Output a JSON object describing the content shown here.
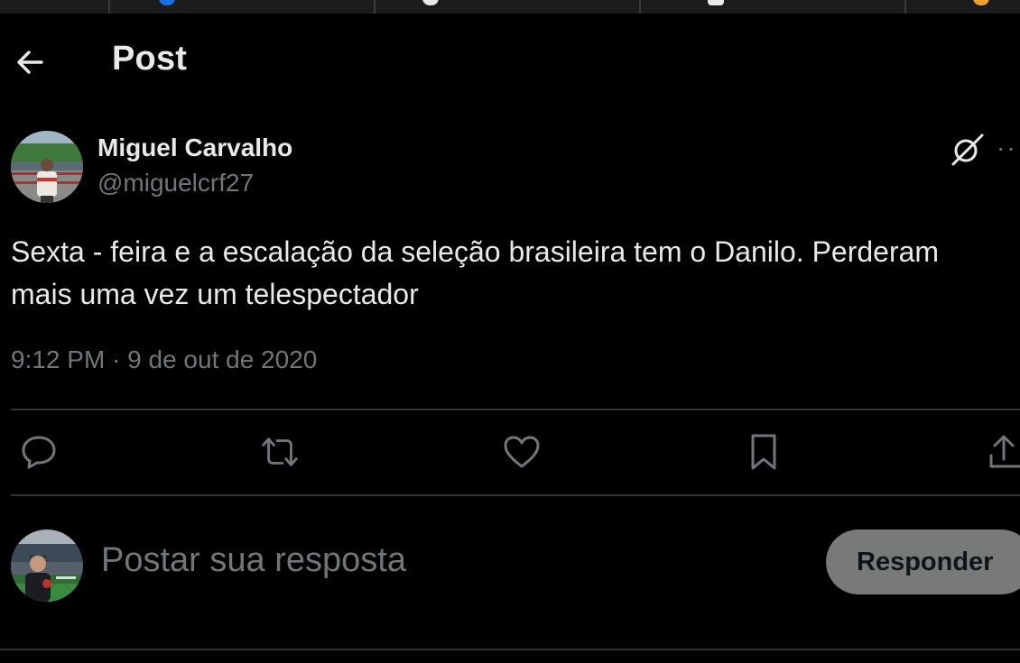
{
  "header": {
    "title": "Post",
    "back_icon": "arrow-left-icon"
  },
  "post": {
    "author_name": "Miguel Carvalho",
    "author_handle": "@miguelcrf27",
    "text_line1": "Sexta - feira e a escalação da seleção brasileira tem o Danilo. Perderam",
    "text_line2": "mais uma vez um telespectador",
    "timestamp": "9:12 PM · 9 de out de 2020",
    "more_label": "··"
  },
  "actions": [
    "reply-icon",
    "repost-icon",
    "like-icon",
    "bookmark-icon",
    "share-icon"
  ],
  "compose": {
    "placeholder": "Postar sua resposta",
    "reply_button": "Responder"
  },
  "colors": {
    "background": "#000000",
    "text_primary": "#e7e9ea",
    "text_secondary": "#71767b",
    "divider": "#2f3336",
    "button_disabled": "#787a7a"
  }
}
